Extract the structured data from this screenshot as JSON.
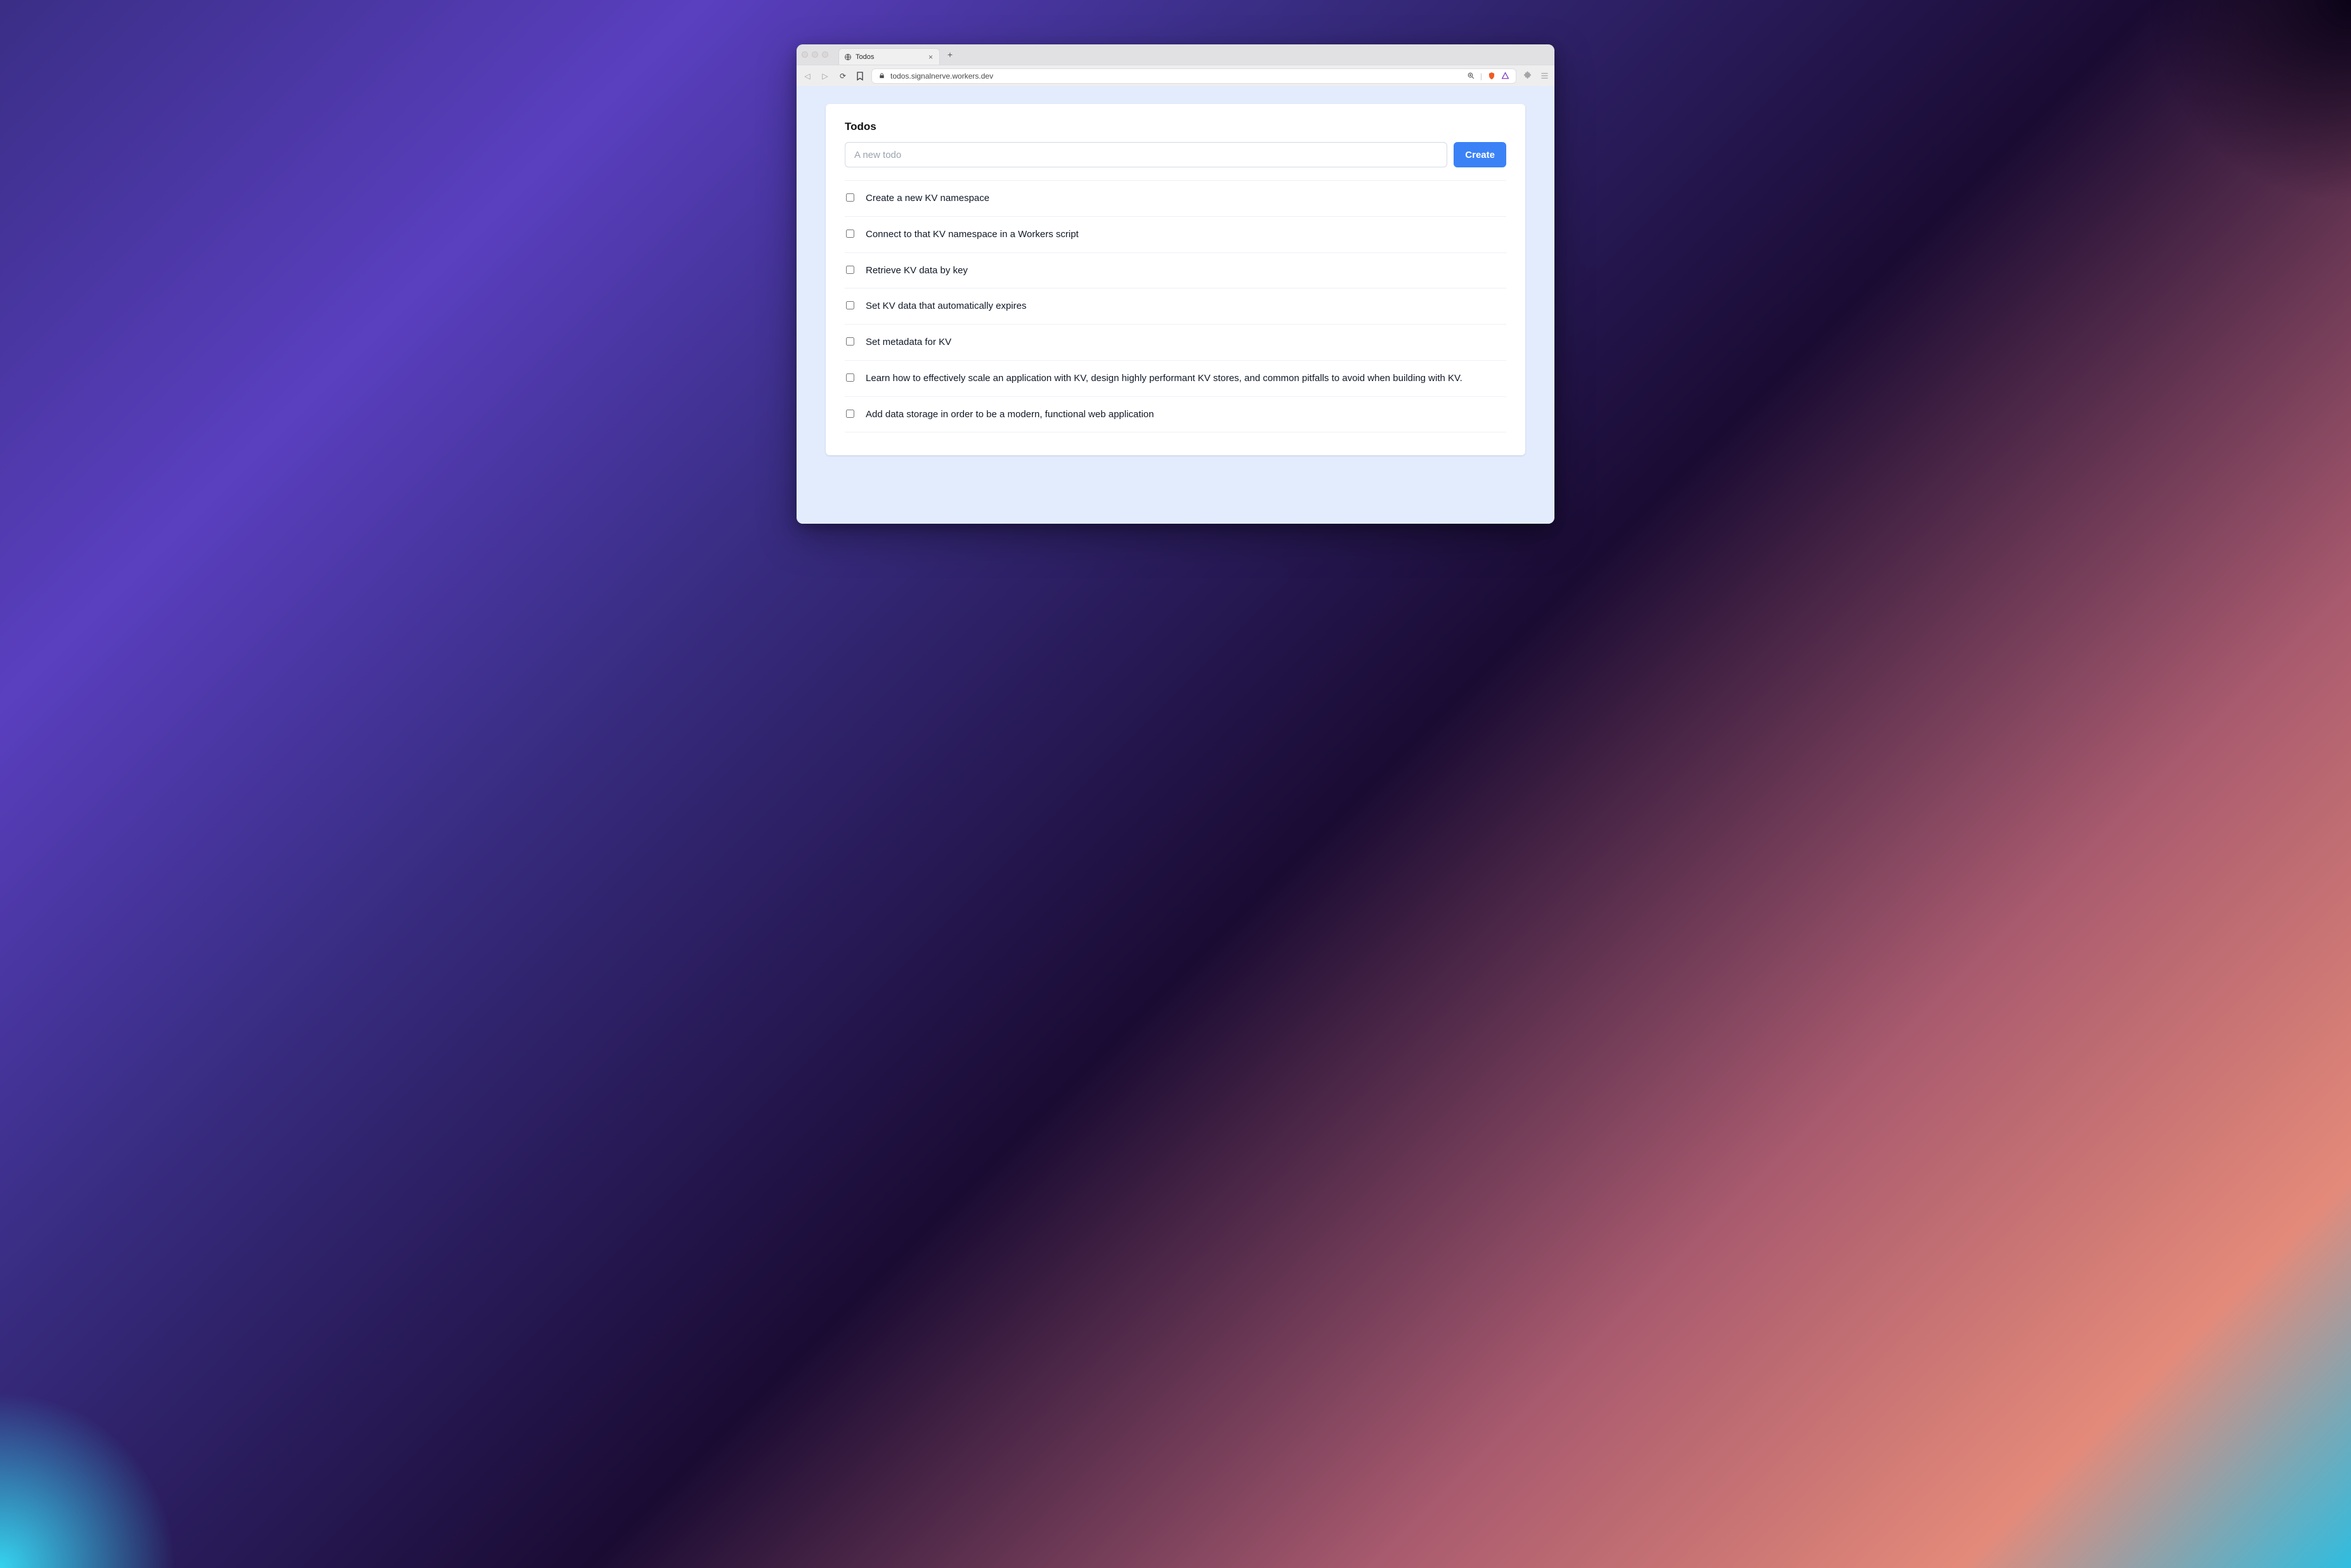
{
  "browser": {
    "tab_title": "Todos",
    "url": "todos.signalnerve.workers.dev"
  },
  "app": {
    "heading": "Todos",
    "input_placeholder": "A new todo",
    "create_label": "Create",
    "todos": [
      {
        "text": "Create a new KV namespace",
        "done": false
      },
      {
        "text": "Connect to that KV namespace in a Workers script",
        "done": false
      },
      {
        "text": "Retrieve KV data by key",
        "done": false
      },
      {
        "text": "Set KV data that automatically expires",
        "done": false
      },
      {
        "text": "Set metadata for KV",
        "done": false
      },
      {
        "text": "Learn how to effectively scale an application with KV, design highly performant KV stores, and common pitfalls to avoid when building with KV.",
        "done": false
      },
      {
        "text": "Add data storage in order to be a modern, functional web application",
        "done": false
      }
    ]
  }
}
